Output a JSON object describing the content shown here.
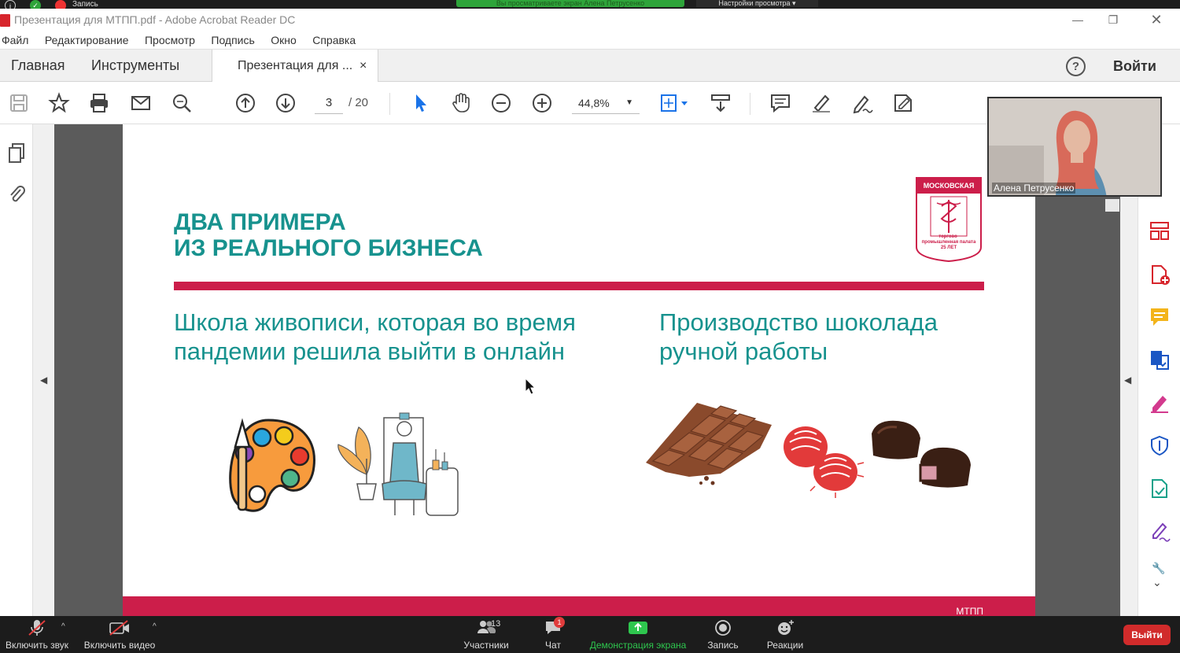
{
  "zoom_top": {
    "record_label": "Запись",
    "share_banner": "Вы просматриваете экран Алена Петрусенко",
    "view_settings": "Настройки просмотра ▾"
  },
  "window": {
    "title": "Презентация для МТПП.pdf - Adobe Acrobat Reader DC"
  },
  "menu": [
    "Файл",
    "Редактирование",
    "Просмотр",
    "Подпись",
    "Окно",
    "Справка"
  ],
  "tabs": {
    "home": "Главная",
    "tools": "Инструменты",
    "document": "Презентация для ...",
    "close": "×",
    "help": "?",
    "login": "Войти"
  },
  "toolbar": {
    "page_current": "3",
    "page_total": "/  20",
    "zoom_value": "44,8%"
  },
  "slide": {
    "title_line1": "ДВА ПРИМЕРА",
    "title_line2": "ИЗ РЕАЛЬНОГО БИЗНЕСА",
    "left_text": "Школа живописи, которая во время пандемии решила выйти в онлайн",
    "right_text": "Производство шоколада ручной работы",
    "logo_top": "МОСКОВСКАЯ",
    "logo_caption": "торгово-промышленная палата 25 ЛЕТ",
    "footer_text": "МТПП"
  },
  "video": {
    "participant_name": "Алена Петрусенко"
  },
  "zoombar": {
    "mic": "Включить звук",
    "video": "Включить видео",
    "participants": "Участники",
    "participants_count": "13",
    "chat": "Чат",
    "chat_badge": "1",
    "share": "Демонстрация экрана",
    "record": "Запись",
    "reactions": "Реакции",
    "leave": "Выйти"
  },
  "colors": {
    "teal": "#17928e",
    "crimson": "#cc1e4a",
    "share_green": "#2ea43a"
  }
}
